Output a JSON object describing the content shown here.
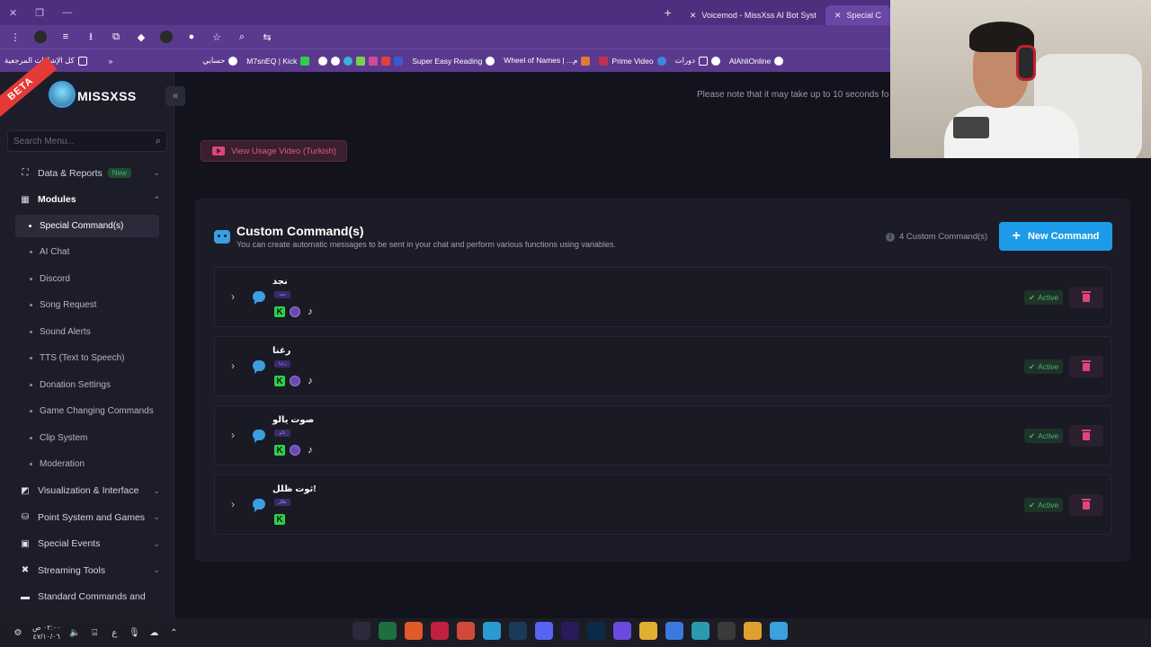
{
  "browser": {
    "tabs": [
      {
        "label": "Voicemod - MissXss AI Bot Syst",
        "active": false
      },
      {
        "label": "Special C",
        "active": true
      }
    ],
    "bookmarks": [
      "كل الإشارات المرجعية",
      "حسابي",
      "M7snEQ | Kick",
      "Super Easy Reading",
      "Wheel of Names | ...م",
      "Prime Video",
      "دورات",
      "AlAhliOnline"
    ]
  },
  "brand": {
    "beta_label": "BETA",
    "name": "MISSXSS"
  },
  "sidebar": {
    "search_placeholder": "Search Menu...",
    "items": [
      {
        "label": "Data & Reports",
        "badge": "New",
        "icon": "chart-icon"
      },
      {
        "label": "Modules",
        "icon": "modules-icon"
      }
    ],
    "subitems": [
      "Special Command(s)",
      "AI Chat",
      "Discord",
      "Song Request",
      "Sound Alerts",
      "TTS (Text to Speech)",
      "Donation Settings",
      "Game Changing Commands",
      "Clip System",
      "Moderation"
    ],
    "sections": [
      {
        "label": "Visualization & Interface",
        "icon": "paint-icon"
      },
      {
        "label": "Point System and Games",
        "icon": "coins-icon"
      },
      {
        "label": "Special Events",
        "icon": "star-icon"
      },
      {
        "label": "Streaming Tools",
        "icon": "tools-icon"
      },
      {
        "label": "Standard Commands and",
        "icon": "list-icon"
      }
    ]
  },
  "header": {
    "note": "Please note that it may take up to 10 seconds fo"
  },
  "video_button": {
    "label": "View Usage Video (Turkish)"
  },
  "panel": {
    "title": "Custom Command(s)",
    "subtitle": "You can create automatic messages to be sent in your chat and perform various functions using variables.",
    "count_label": "4 Custom Command(s)",
    "new_button": "New Command"
  },
  "commands": [
    {
      "name": "نجد",
      "tag": "نجد",
      "platforms": [
        "kick",
        "twitch",
        "tiktok"
      ],
      "status": "Active"
    },
    {
      "name": "رغنا",
      "tag": "رغنا",
      "platforms": [
        "kick",
        "twitch",
        "tiktok"
      ],
      "status": "Active"
    },
    {
      "name": "صوت يالو",
      "tag": "يالو",
      "platforms": [
        "kick",
        "twitch",
        "tiktok"
      ],
      "status": "Active"
    },
    {
      "name": "ثوت ظلل!",
      "tag": "ظلل",
      "platforms": [
        "kick"
      ],
      "status": "Active"
    }
  ],
  "taskbar": {
    "clock_time": "٠٢:٠٠ ص",
    "clock_date": "٤٧/١٠/٠٦",
    "lang": "ع"
  },
  "colors": {
    "accent": "#1e9be8",
    "active": "#4caf80",
    "danger": "#e0457a",
    "browser_frame": "#5a3a8e"
  }
}
